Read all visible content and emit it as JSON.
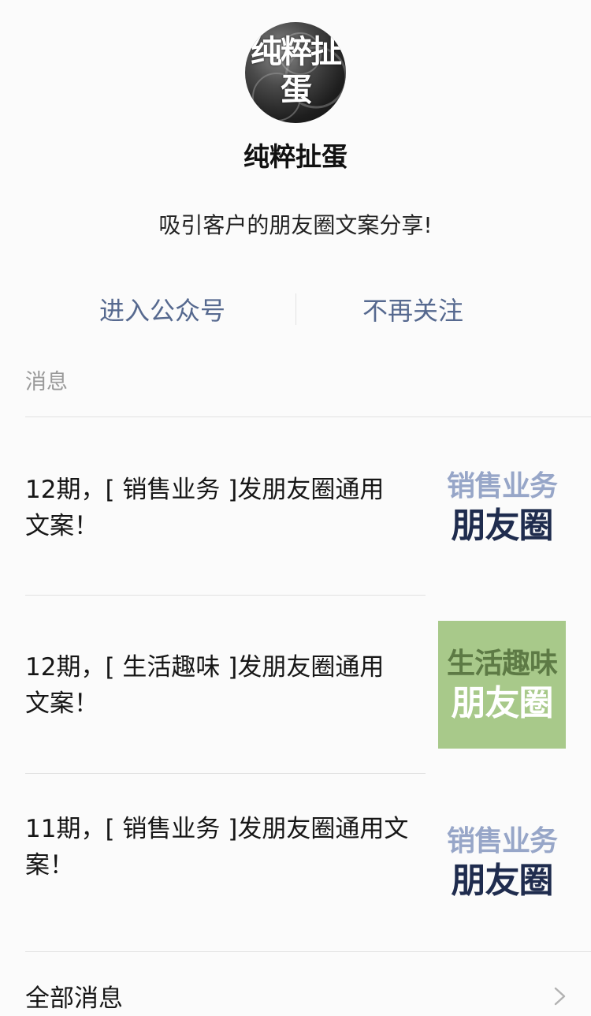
{
  "account": {
    "avatar_text": "纯粹扯蛋",
    "name": "纯粹扯蛋",
    "description": "吸引客户的朋友圈文案分享!"
  },
  "actions": {
    "enter": "进入公众号",
    "unfollow": "不再关注"
  },
  "section_label": "消息",
  "messages": [
    {
      "title": "12期，[ 销售业务 ]发朋友圈通用文案！",
      "thumb_line1": "销售业务",
      "thumb_line2": "朋友圈"
    },
    {
      "title": "12期，[ 生活趣味 ]发朋友圈通用文案！",
      "thumb_line1": "生活趣味",
      "thumb_line2": "朋友圈"
    },
    {
      "title": "11期，[ 销售业务 ]发朋友圈通用文案！",
      "thumb_line1": "销售业务",
      "thumb_line2": "朋友圈"
    }
  ],
  "all_messages": "全部消息",
  "colors": {
    "link": "#56698f",
    "thumb_dark": "#1f2c4e",
    "thumb_light": "#97a6c8",
    "thumb_green": "#a8c98a"
  }
}
